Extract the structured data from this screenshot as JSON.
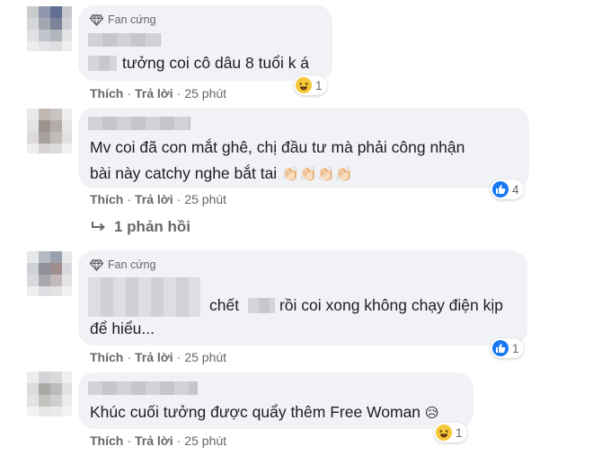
{
  "comments": [
    {
      "badge": "Fan cứng",
      "text": "tưởng coi cô dâu 8 tuổi k á",
      "like": "Thích",
      "reply": "Trả lời",
      "time": "25 phút",
      "reaction_count": "1",
      "reaction_icon": "laugh-emoji-icon"
    },
    {
      "text_line1": "Mv coi đã con mắt ghê, chị đầu tư mà phải công nhận",
      "text_line2": "bài này catchy nghe bắt tai",
      "text_emoji": "👏🏻👏🏻👏🏻👏🏻",
      "like": "Thích",
      "reply": "Trả lời",
      "time": "25 phút",
      "reaction_count": "4",
      "reaction_icon": "like-icon",
      "replies_label": "1 phản hồi"
    },
    {
      "badge": "Fan cứng",
      "text_part1": "chết",
      "text_part2": "rồi coi xong không chạy điện kịp",
      "text_line2": "để hiểu...",
      "like": "Thích",
      "reply": "Trả lời",
      "time": "25 phút",
      "reaction_count": "1",
      "reaction_icon": "like-icon"
    },
    {
      "text": "Khúc cuối tưởng được quẩy thêm Free Woman",
      "text_emoji": "😥",
      "like": "Thích",
      "reply": "Trả lời",
      "time": "25 phút",
      "reaction_count": "1",
      "reaction_icon": "laugh-emoji-icon"
    }
  ],
  "colors": {
    "bubble": "#f0f2f5",
    "meta": "#65676b",
    "like_blue": "#1877f2",
    "emoji_yellow": "#f7c83b"
  }
}
